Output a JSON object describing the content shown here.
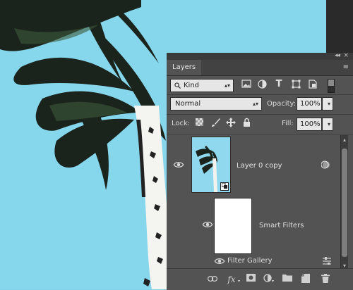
{
  "photo": {
    "alt": "palm tree against blue sky"
  },
  "panel": {
    "tab_label": "Layers",
    "collapse_glyph": "◂◂",
    "close_glyph": "×",
    "menu_glyph": "≡",
    "filter": {
      "kind_label": "Kind",
      "kind_icon": "search-icon"
    },
    "blend": {
      "mode": "Normal",
      "opacity_label": "Opacity:",
      "opacity_value": "100%"
    },
    "lock": {
      "label": "Lock:",
      "fill_label": "Fill:",
      "fill_value": "100%"
    },
    "layers": [
      {
        "name": "Layer 0 copy",
        "visible": true,
        "smart_object": true
      }
    ],
    "smart_filters_label": "Smart Filters",
    "filter_gallery_label": "Filter Gallery"
  },
  "colors": {
    "panel_bg": "#535353",
    "sky": "#86d6ec",
    "dark_ui": "#2a2a2a"
  }
}
